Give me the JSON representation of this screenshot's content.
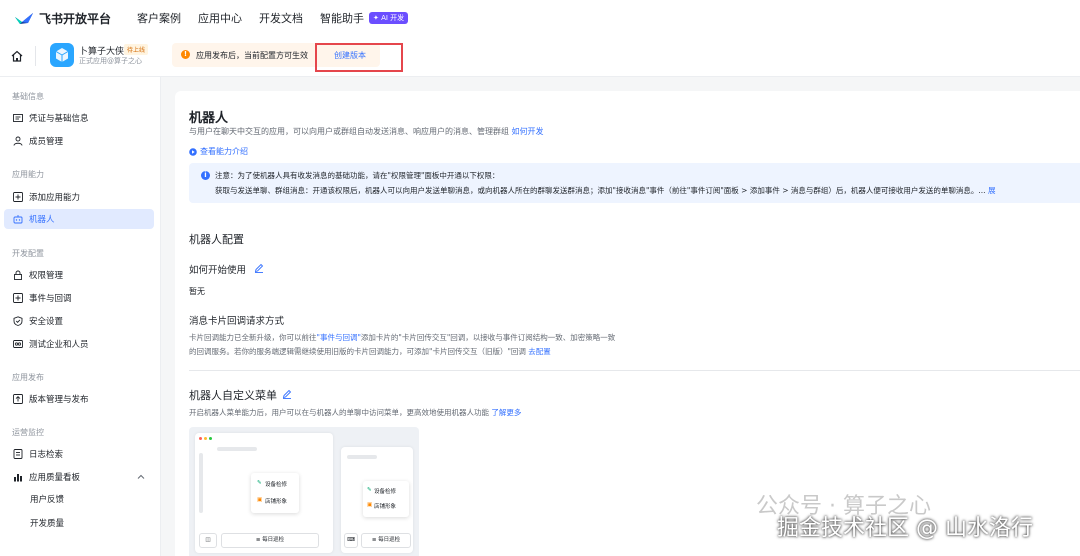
{
  "topnav": {
    "brand": "飞书开放平台",
    "items": [
      "客户案例",
      "应用中心",
      "开发文档",
      "智能助手"
    ],
    "ai_badge": "✦ AI 开发"
  },
  "appbar": {
    "app_name": "卜算子大侠",
    "app_status": "待上线",
    "app_subtitle": "正式应用@算子之心",
    "notice": "应用发布后，当前配置方可生效",
    "create_version": "创建版本"
  },
  "sidebar": {
    "groups": [
      {
        "title": "基础信息",
        "items": [
          "凭证与基础信息",
          "成员管理"
        ]
      },
      {
        "title": "应用能力",
        "items": [
          "添加应用能力",
          "机器人"
        ]
      },
      {
        "title": "开发配置",
        "items": [
          "权限管理",
          "事件与回调",
          "安全设置",
          "测试企业和人员"
        ]
      },
      {
        "title": "应用发布",
        "items": [
          "版本管理与发布"
        ]
      },
      {
        "title": "运营监控",
        "items": [
          "日志检索",
          "应用质量看板"
        ]
      }
    ],
    "sub_items": [
      "用户反馈",
      "开发质量"
    ],
    "active_item": "机器人"
  },
  "main": {
    "title": "机器人",
    "description": "与用户在聊天中交互的应用，可以向用户或群组自动发送消息、响应用户的消息、管理群组",
    "description_link": "如何开发",
    "capability_link": "查看能力介绍",
    "info_line1": "注意：为了使机器人具有收发消息的基础功能，请在\"权限管理\"面板中开通以下权限：",
    "info_line2": "获取与发送单聊、群组消息：开通该权限后，机器人可以向用户发送单聊消息，或向机器人所在的群聊发送群消息；添加\"接收消息\"事件（前往\"事件订阅\"面板 > 添加事件 > 消息与群组）后，机器人便可接收用户发送的单聊消息。...",
    "info_more": "展",
    "config_title": "机器人配置",
    "howto_title": "如何开始使用",
    "howto_value": "暂无",
    "callback_title": "消息卡片回调请求方式",
    "callback_line1_pre": "卡片回调能力已全新升级，你可以前往",
    "callback_line1_link": "\"事件与回调\"",
    "callback_line1_post": "添加卡片的\"卡片回传交互\"回调，以接收与事件订阅结构一致、加密策略一致",
    "callback_line2_pre": "的回调服务。若你的服务端逻辑需继续使用旧版的卡片回调能力，可添加\"卡片回传交互（旧版）\"回调 ",
    "callback_line2_link": "去配置",
    "menu_title": "机器人自定义菜单",
    "menu_desc": "开启机器人菜单能力后，用户可以在与机器人的单聊中访问菜单，更高效地使用机器人功能 ",
    "menu_desc_link": "了解更多"
  },
  "illustration": {
    "popup_item_1": "设备检修",
    "popup_item_2": "店铺形象",
    "daily_check": "≡ 每日巡检"
  },
  "watermarks": {
    "gzh": "公众号 · 算子之心",
    "juejin": "掘金技术社区 @ 山水洛行"
  },
  "colors": {
    "accent": "#3370ff",
    "active_bg": "#e1eaff",
    "highlight_box": "#e5464c",
    "notice_bg": "#fff5eb"
  }
}
